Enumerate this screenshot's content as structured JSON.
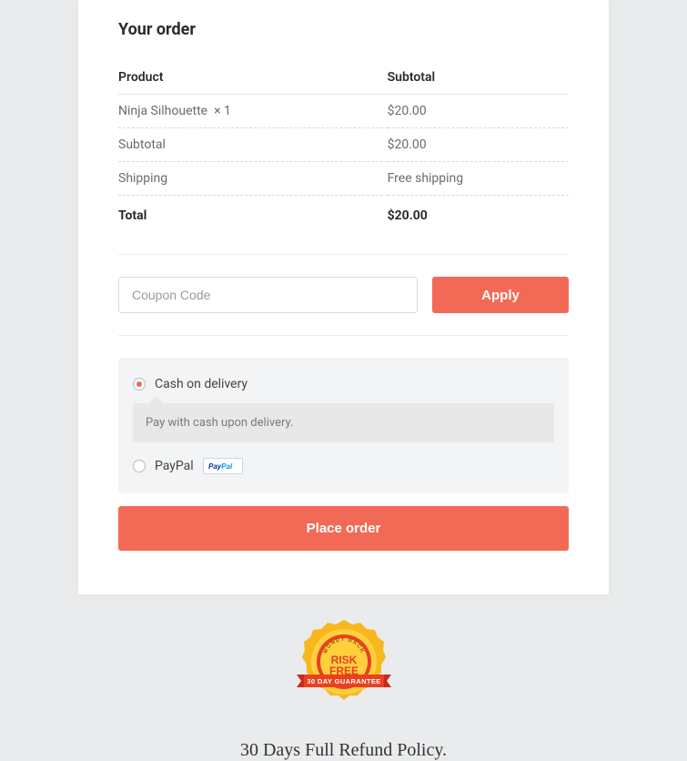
{
  "order": {
    "title": "Your order",
    "headers": {
      "product": "Product",
      "subtotal": "Subtotal"
    },
    "line_item": {
      "name": "Ninja Silhouette",
      "qty": "× 1",
      "price": "$20.00"
    },
    "subtotal": {
      "label": "Subtotal",
      "value": "$20.00"
    },
    "shipping": {
      "label": "Shipping",
      "value": "Free shipping"
    },
    "total": {
      "label": "Total",
      "value": "$20.00"
    }
  },
  "coupon": {
    "placeholder": "Coupon Code",
    "apply_label": "Apply"
  },
  "payment": {
    "cod": {
      "label": "Cash on delivery",
      "description": "Pay with cash upon delivery."
    },
    "paypal": {
      "label": "PayPal"
    }
  },
  "place_order_label": "Place order",
  "refund": {
    "badge_top": "MONEY BACK",
    "badge_center1": "RISK",
    "badge_center2": "FREE",
    "badge_ribbon": "30 DAY GUARANTEE",
    "policy": "30 Days Full Refund Policy."
  }
}
